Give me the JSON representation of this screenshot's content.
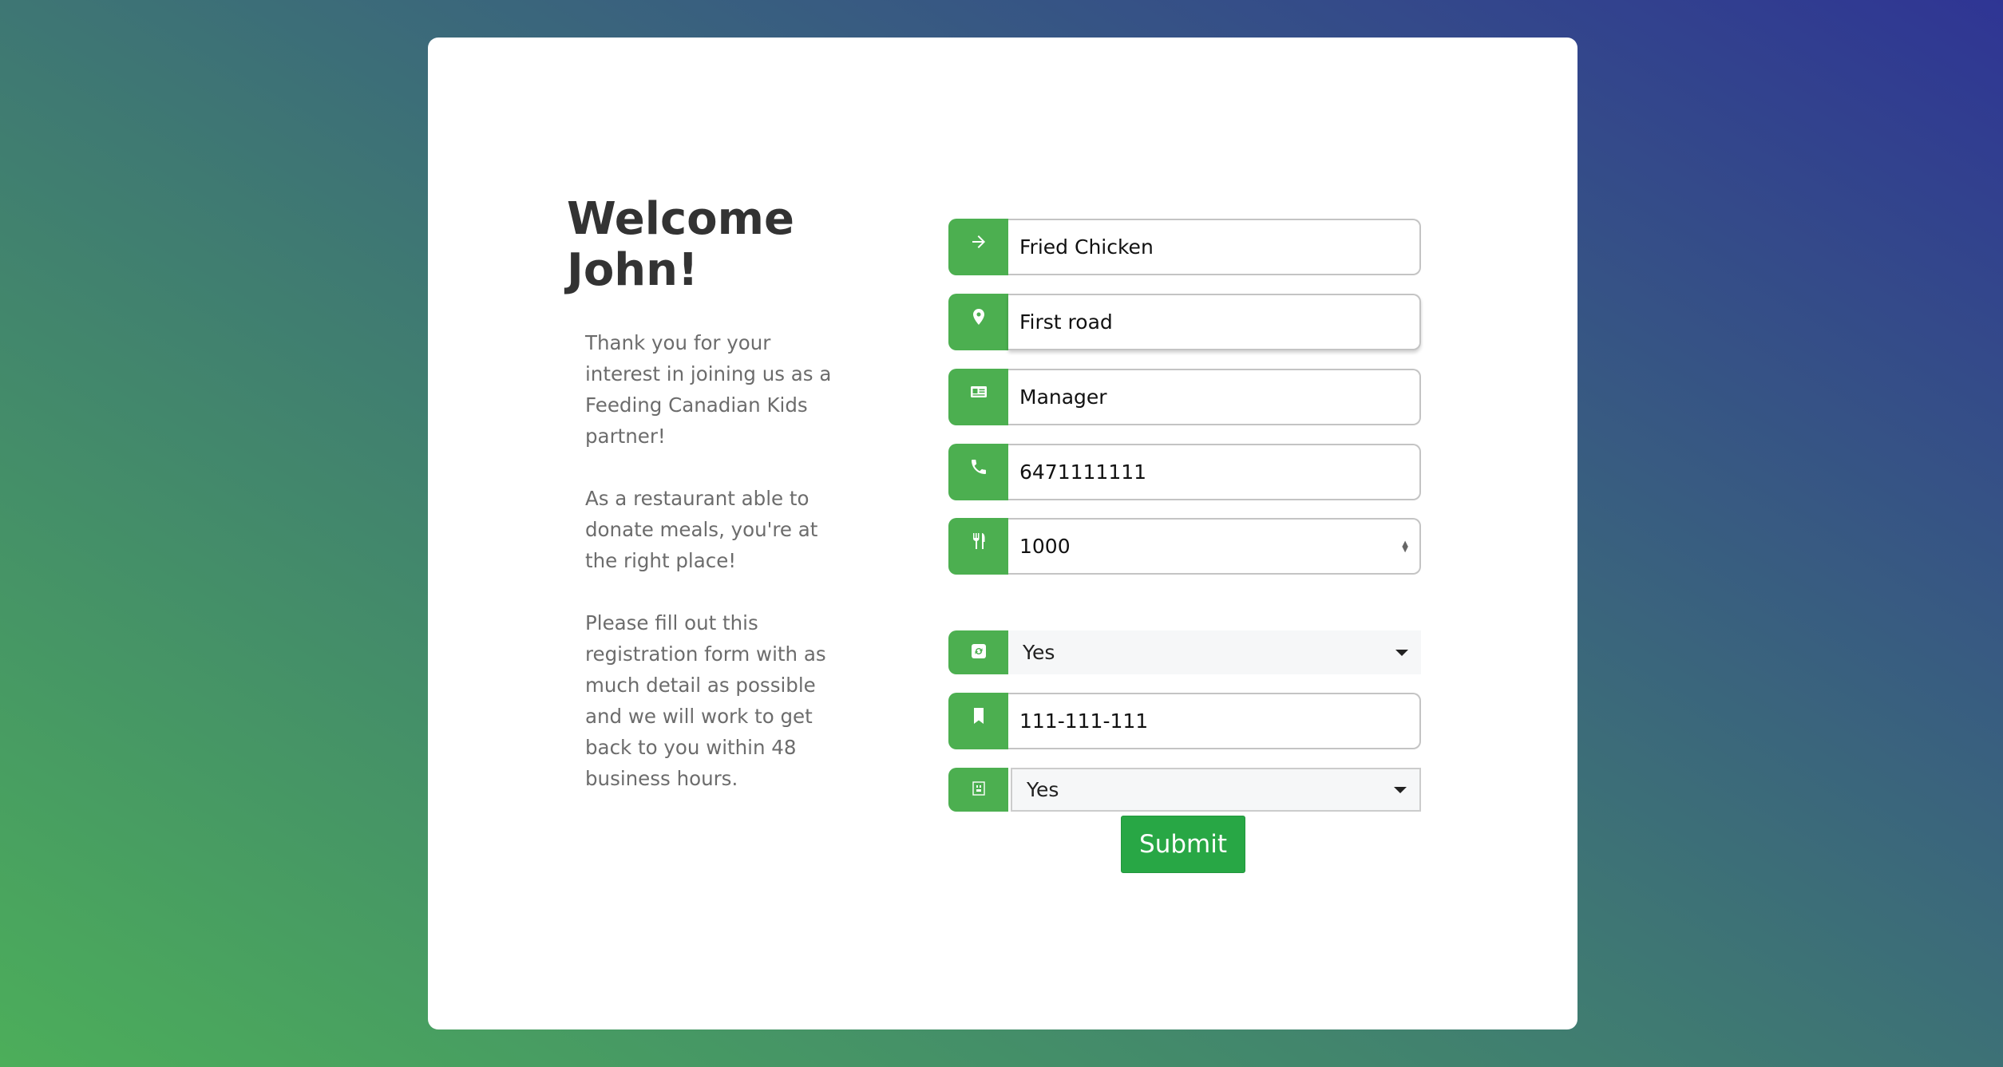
{
  "welcome": {
    "title": "Welcome John!",
    "paragraphs": [
      "Thank you for your interest in joining us as a Feeding Canadian Kids partner!",
      "As a restaurant able to donate meals, you're at the right place!",
      "Please fill out this registration form with as much detail as possible and we will work to get back to you within 48 business hours."
    ]
  },
  "form": {
    "fields": [
      {
        "icon": "arrow-right-icon",
        "value": "Fried Chicken"
      },
      {
        "icon": "map-marker-icon",
        "value": "First road"
      },
      {
        "icon": "id-card-icon",
        "value": "Manager"
      },
      {
        "icon": "phone-icon",
        "value": "6471111111"
      },
      {
        "icon": "utensils-icon",
        "value": "1000"
      },
      {
        "icon": "delivery-icon",
        "value": "Yes"
      },
      {
        "icon": "bookmark-icon",
        "value": "111-111-111"
      },
      {
        "icon": "calendar-icon",
        "value": "Yes"
      }
    ],
    "submit_label": "Submit"
  },
  "colors": {
    "accent": "#4caf50",
    "submit": "#28a745",
    "heading": "#333333",
    "body_text": "#6c6c6c"
  }
}
